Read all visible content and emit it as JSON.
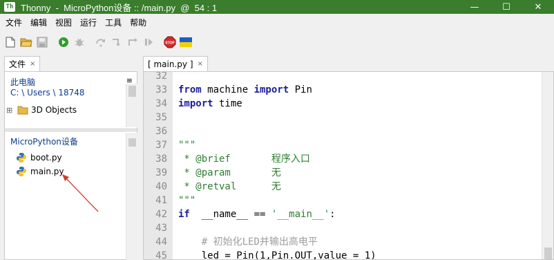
{
  "window": {
    "title": "Thonny  -  MicroPython设备 :: /main.py  @  54 : 1",
    "app_icon_text": "Th",
    "controls": {
      "minimize": "—",
      "maximize": "☐",
      "close": "✕"
    }
  },
  "menu": [
    "文件",
    "编辑",
    "视图",
    "运行",
    "工具",
    "帮助"
  ],
  "toolbar": {
    "icons": [
      "new-file-icon",
      "open-folder-icon",
      "save-icon",
      "run-icon",
      "debug-icon",
      "step-over-icon",
      "step-into-icon",
      "step-out-icon",
      "resume-icon",
      "stop-icon",
      "ukraine-flag-icon"
    ],
    "colors": {
      "run": "#2e9e2e",
      "stop": "#d42a2a",
      "flag_blue": "#1a5fc9",
      "flag_yellow": "#f5d000",
      "disabled": "#b8b8b8"
    }
  },
  "files_panel": {
    "tab_label": "文件",
    "tab_close": "×",
    "computer_section": {
      "title": "此电脑",
      "path": "C: \\ Users \\ 18748",
      "items": [
        {
          "expander": "⊞",
          "label": "3D Objects"
        }
      ]
    },
    "device_section": {
      "title": "MicroPython设备",
      "items": [
        {
          "label": "boot.py"
        },
        {
          "label": "main.py"
        }
      ]
    },
    "menu_glyph": "≡"
  },
  "editor": {
    "tab_label": "[ main.py ]",
    "tab_close": "×",
    "lines": [
      {
        "n": "32",
        "segments": []
      },
      {
        "n": "33",
        "segments": [
          {
            "t": "from",
            "c": "kw"
          },
          {
            "t": " machine ",
            "c": ""
          },
          {
            "t": "import",
            "c": "kw"
          },
          {
            "t": " Pin",
            "c": ""
          }
        ]
      },
      {
        "n": "34",
        "segments": [
          {
            "t": "import",
            "c": "kw"
          },
          {
            "t": " time",
            "c": ""
          }
        ]
      },
      {
        "n": "35",
        "segments": []
      },
      {
        "n": "36",
        "segments": []
      },
      {
        "n": "37",
        "segments": [
          {
            "t": "\"\"\"",
            "c": "str"
          }
        ]
      },
      {
        "n": "38",
        "segments": [
          {
            "t": " * @brief       程序入口",
            "c": "str"
          }
        ]
      },
      {
        "n": "39",
        "segments": [
          {
            "t": " * @param       无",
            "c": "str"
          }
        ]
      },
      {
        "n": "40",
        "segments": [
          {
            "t": " * @retval      无",
            "c": "str"
          }
        ]
      },
      {
        "n": "41",
        "segments": [
          {
            "t": "\"\"\"",
            "c": "str"
          }
        ]
      },
      {
        "n": "42",
        "segments": [
          {
            "t": "if",
            "c": "kw"
          },
          {
            "t": "  __name__ == ",
            "c": ""
          },
          {
            "t": "'__main__'",
            "c": "str"
          },
          {
            "t": ":",
            "c": ""
          }
        ]
      },
      {
        "n": "43",
        "segments": []
      },
      {
        "n": "44",
        "segments": [
          {
            "t": "    # 初始化LED并输出高电平",
            "c": "cmt"
          }
        ]
      },
      {
        "n": "45",
        "segments": [
          {
            "t": "    led = Pin(1,Pin.OUT,value = 1)",
            "c": ""
          }
        ]
      }
    ]
  },
  "annotation": {
    "arrow_color": "#d83a2a"
  }
}
